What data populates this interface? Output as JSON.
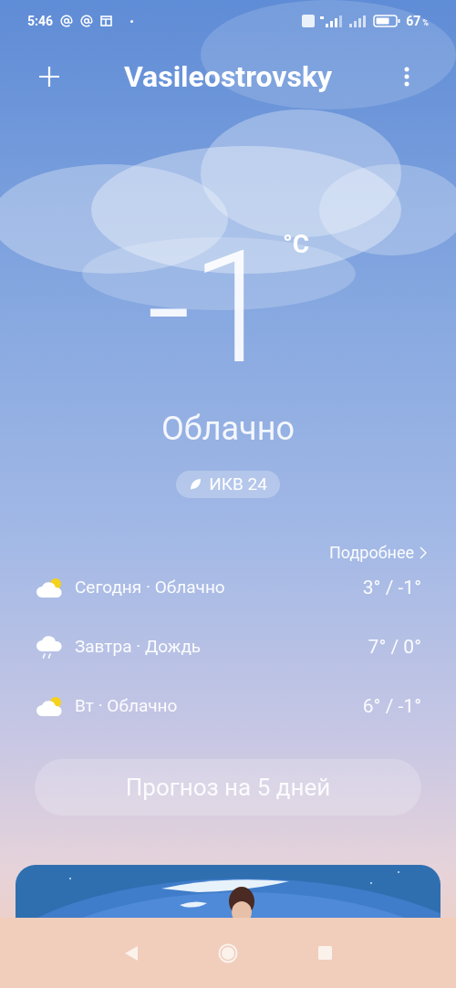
{
  "status_bar": {
    "time": "5:46",
    "battery": "67",
    "battery_unit": "%"
  },
  "header": {
    "title": "Vasileostrovsky"
  },
  "current": {
    "temperature": "-1",
    "unit": "°C",
    "condition": "Облачно",
    "aqi": "ИКВ 24"
  },
  "details_link": "Подробнее",
  "forecast": [
    {
      "kind": "cloudy",
      "label": "Сегодня · Облачно",
      "temps": "3° / -1°"
    },
    {
      "kind": "rain",
      "label": "Завтра · Дождь",
      "temps": "7° / 0°"
    },
    {
      "kind": "cloudy",
      "label": "Вт · Облачно",
      "temps": "6° / -1°"
    }
  ],
  "forecast_button": "Прогноз на 5 дней"
}
